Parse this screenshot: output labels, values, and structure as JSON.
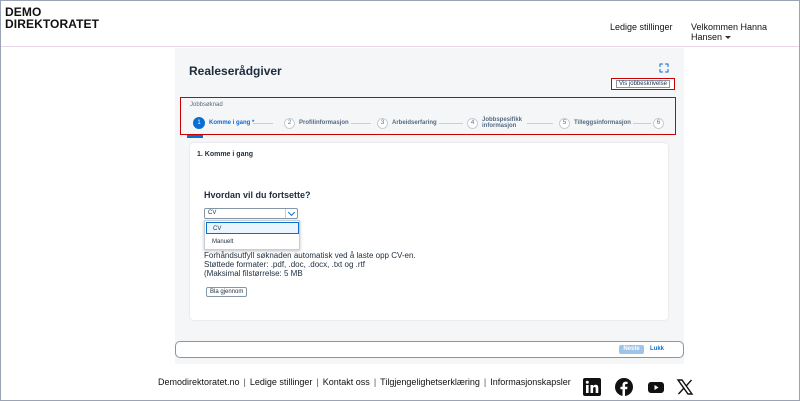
{
  "header": {
    "logo_line1": "DEMO",
    "logo_line2": "DIREKTORATET",
    "nav_jobs": "Ledige stillinger",
    "nav_user": "Velkommen Hanna Hansen"
  },
  "job": {
    "title": "Realeserådgiver",
    "view_description": "Vis jobbeskrivelse"
  },
  "progress": {
    "label": "Jobbsøknad",
    "steps": [
      {
        "num": "1",
        "label": "Komme i gang *",
        "active": true
      },
      {
        "num": "2",
        "label": "Profilinformasjon"
      },
      {
        "num": "3",
        "label": "Arbeidserfaring"
      },
      {
        "num": "4",
        "label_line1": "Jobbspesifikk",
        "label_line2": "informasjon"
      },
      {
        "num": "5",
        "label": "Tilleggsinformasjon"
      },
      {
        "num": "6"
      }
    ]
  },
  "section": {
    "title": "1. Komme i gang",
    "question": "Hvordan vil du fortsette?",
    "select_value": "CV",
    "options": [
      "CV",
      "Manuelt"
    ],
    "info_line1": "Forhåndsutfyll søknaden automatisk ved å laste opp CV-en.",
    "info_line2": "Støttede formater: .pdf, .doc, .docx, .txt og .rtf",
    "info_line3": "(Maksimal filstørrelse: 5 MB",
    "browse": "Bla gjennom"
  },
  "toolbar": {
    "next": "Neste",
    "close": "Lukk"
  },
  "footer": {
    "links": [
      "Demodirektoratet.no",
      "Ledige stillinger",
      "Kontakt oss",
      "Tilgjengelighetserklæring",
      "Informasjonskapsler"
    ],
    "sep": "|",
    "social_icons": [
      "linkedin-icon",
      "facebook-icon",
      "youtube-icon",
      "x-icon"
    ]
  },
  "colors": {
    "accent": "#0a6ed1",
    "highlight_border": "#cc0000",
    "text": "#1d2d3e",
    "panel_bg": "#f5f6f7"
  }
}
